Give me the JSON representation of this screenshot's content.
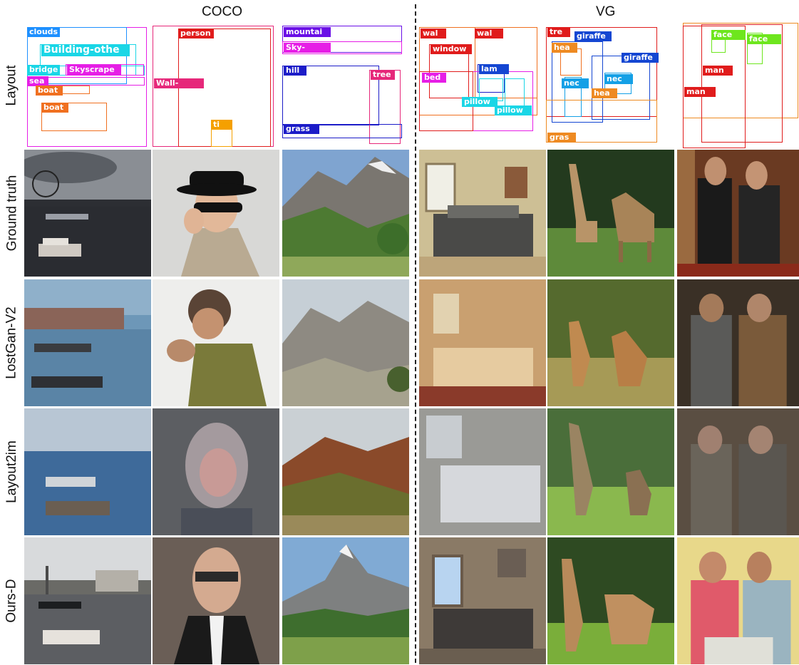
{
  "headers": {
    "coco": "COCO",
    "vg": "VG"
  },
  "row_labels": [
    "Layout",
    "Ground truth",
    "LostGan-V2",
    "Layout2im",
    "Ours-D"
  ],
  "colors": {
    "blue": "#1e90ff",
    "cyan": "#1ad6e6",
    "magenta": "#e61ee6",
    "orange": "#f07020",
    "pink": "#e6287a",
    "purple": "#6a0fe6",
    "navy": "#1c1cc8",
    "red": "#e01c1c",
    "amber": "#f5a000",
    "green": "#6ee61e",
    "darkblue": "#1446d2",
    "skyblue": "#14a0e6",
    "orange2": "#ee8a22"
  },
  "layouts": {
    "coco1": [
      "clouds",
      "Building-othe",
      "bridge",
      "Skyscrape",
      "sea",
      "boat",
      "boat"
    ],
    "coco2": [
      "person",
      "Wall-",
      "ti"
    ],
    "coco3": [
      "mountai",
      "Sky-",
      "hill",
      "tree",
      "grass"
    ],
    "vg1": [
      "wal",
      "wal",
      "window",
      "lam",
      "bed",
      "pillow",
      "pillow"
    ],
    "vg2": [
      "tre",
      "giraffe",
      "hea",
      "giraffe",
      "nec",
      "nec",
      "hea",
      "gras"
    ],
    "vg3": [
      "face",
      "face",
      "man",
      "man"
    ]
  }
}
